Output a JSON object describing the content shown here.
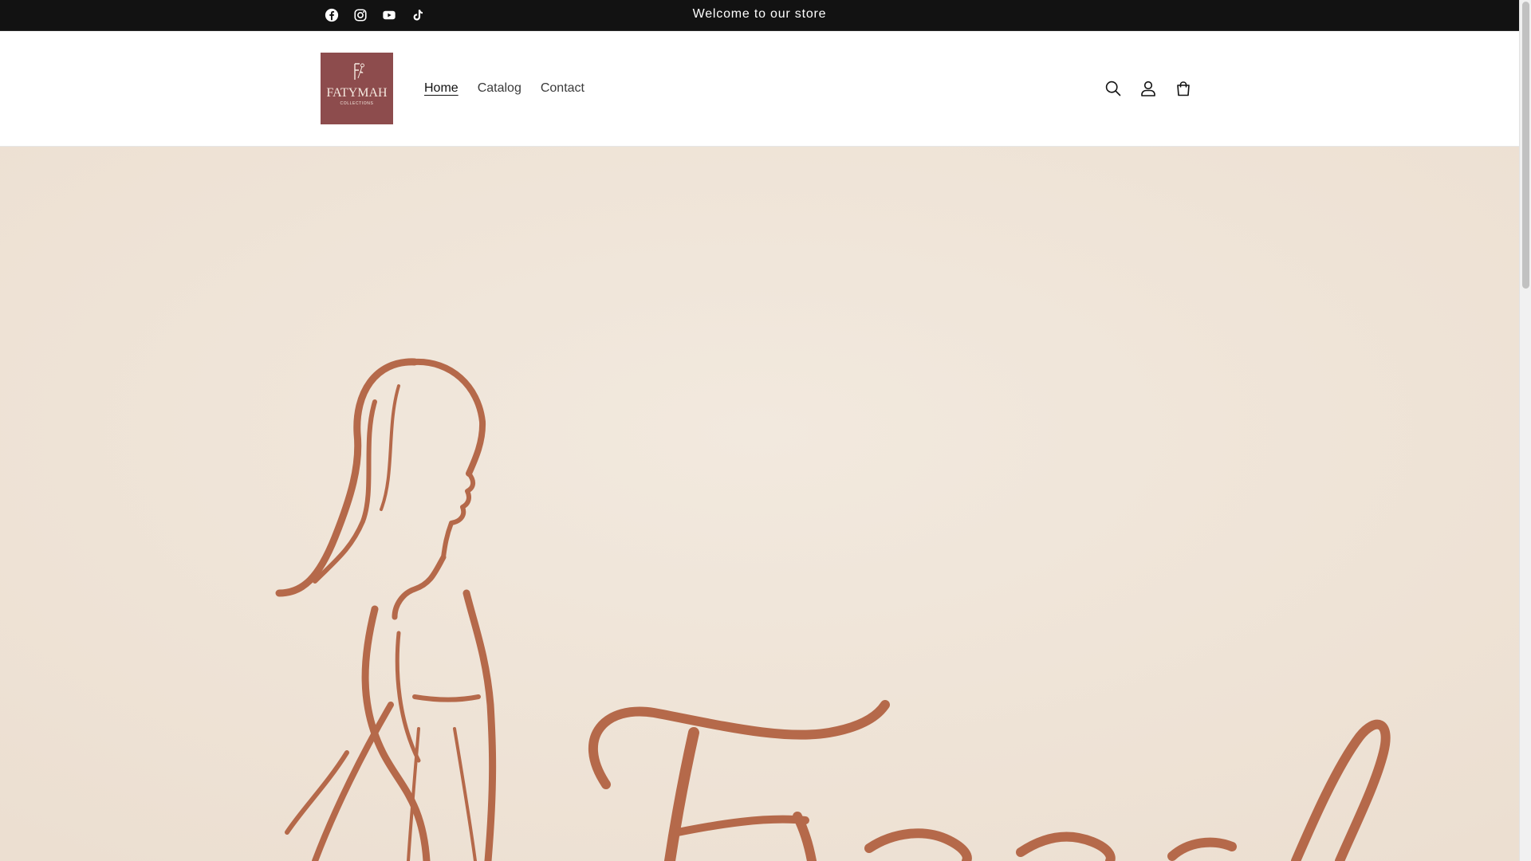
{
  "announcement": {
    "text": "Welcome to our store"
  },
  "socials": [
    {
      "icon": "facebook-icon",
      "label": "Facebook"
    },
    {
      "icon": "instagram-icon",
      "label": "Instagram"
    },
    {
      "icon": "youtube-icon",
      "label": "YouTube"
    },
    {
      "icon": "tiktok-icon",
      "label": "TikTok"
    }
  ],
  "logo": {
    "alt": "FATYMAH COLLECTIONS",
    "name": "FATYMAH",
    "sub": "COLLECTIONS",
    "background": "#8d4c4d"
  },
  "nav": {
    "home": "Home",
    "catalog": "Catalog",
    "contact": "Contact",
    "active": "Home"
  },
  "header_icons": {
    "search": "search-icon",
    "account": "account-icon",
    "cart": "cart-icon"
  },
  "hero": {
    "alt": "Fatymah",
    "background": "#f0e6db",
    "ink": "#b5694a"
  },
  "colors": {
    "topbar": "#121212",
    "text": "#121212"
  }
}
